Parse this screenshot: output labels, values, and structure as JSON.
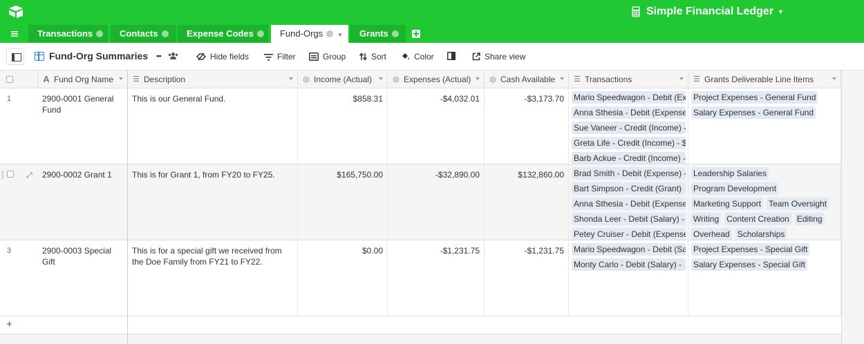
{
  "app": {
    "base_title": "Simple Financial Ledger",
    "brand_color": "#20c933",
    "accent_color": "#2d7ff9"
  },
  "tabs": [
    {
      "label": "Transactions",
      "active": false
    },
    {
      "label": "Contacts",
      "active": false
    },
    {
      "label": "Expense Codes",
      "active": false
    },
    {
      "label": "Fund-Orgs",
      "active": true
    },
    {
      "label": "Grants",
      "active": false
    }
  ],
  "toolbar": {
    "view_name": "Fund-Org Summaries",
    "more": "•••",
    "hide_fields": "Hide fields",
    "filter": "Filter",
    "group": "Group",
    "sort": "Sort",
    "color": "Color",
    "share_view": "Share view"
  },
  "columns": [
    {
      "label": "Fund Org Name",
      "icon": "text-icon"
    },
    {
      "label": "Description",
      "icon": "long-text-icon"
    },
    {
      "label": "Income (Actual)",
      "icon": "rollup-icon"
    },
    {
      "label": "Expenses (Actual)",
      "icon": "rollup-icon"
    },
    {
      "label": "Cash Available",
      "icon": "formula-icon"
    },
    {
      "label": "Transactions",
      "icon": "link-icon"
    },
    {
      "label": "Grants Deliverable Line Items",
      "icon": "link-icon"
    }
  ],
  "rows": [
    {
      "num": "1",
      "name": "2900-0001 General Fund",
      "description": "This is our General Fund.",
      "income": "$858.31",
      "expenses": "-$4,032.01",
      "cash": "-$3,173.70",
      "transactions": [
        "Mario Speedwagon - Debit (Ex",
        "Anna Sthesia - Debit (Expense",
        "Sue Vaneer - Credit (Income) -",
        "Greta Life - Credit (Income) - $",
        "Barb Ackue - Credit (Income) -"
      ],
      "grants": [
        "Project Expenses - General Fund",
        "Salary Expenses - General Fund"
      ]
    },
    {
      "num": "",
      "name": "2900-0002 Grant 1",
      "description": "This is for Grant 1, from FY20 to FY25.",
      "income": "$165,750.00",
      "expenses": "-$32,890.00",
      "cash": "$132,860.00",
      "transactions": [
        "Brad Smith - Debit (Expense) -",
        "Bart Simpson - Credit (Grant)",
        "Anna Sthesia - Debit (Expense",
        "Shonda Leer - Debit (Salary) -",
        "Petey Cruiser - Debit (Expense"
      ],
      "grants": [
        "Leadership Salaries",
        "Program Development",
        "Marketing Support",
        "Team Oversight",
        "Writing",
        "Content Creation",
        "Editing",
        "Overhead",
        "Scholarships"
      ]
    },
    {
      "num": "3",
      "name": "2900-0003 Special Gift",
      "description": "This is for a special gift we received from the Doe Family from FY21 to FY22.",
      "income": "$0.00",
      "expenses": "-$1,231.75",
      "cash": "-$1,231.75",
      "transactions": [
        "Mario Speedwagon - Debit (Sa",
        "Monty Carlo - Debit (Salary) -"
      ],
      "grants": [
        "Project Expenses - Special Gift",
        "Salary Expenses - Special Gift"
      ]
    }
  ],
  "add_row": "+"
}
